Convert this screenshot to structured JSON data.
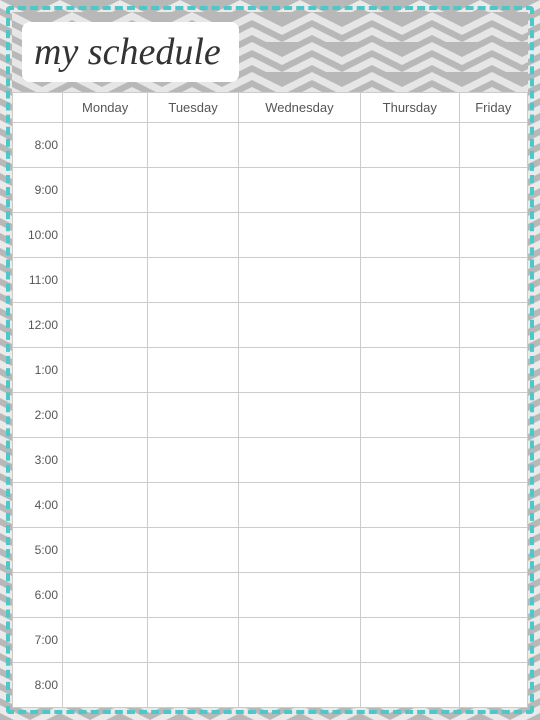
{
  "page": {
    "title": "my schedule",
    "background_color": "#4dc8c8",
    "chevron_color": "#b0b0b0"
  },
  "header": {
    "title": "my schedule"
  },
  "schedule": {
    "days": [
      "",
      "Monday",
      "Tuesday",
      "Wednesday",
      "Thursday",
      "Friday"
    ],
    "times": [
      "8:00",
      "9:00",
      "10:00",
      "11:00",
      "12:00",
      "1:00",
      "2:00",
      "3:00",
      "4:00",
      "5:00",
      "6:00",
      "7:00",
      "8:00"
    ]
  }
}
